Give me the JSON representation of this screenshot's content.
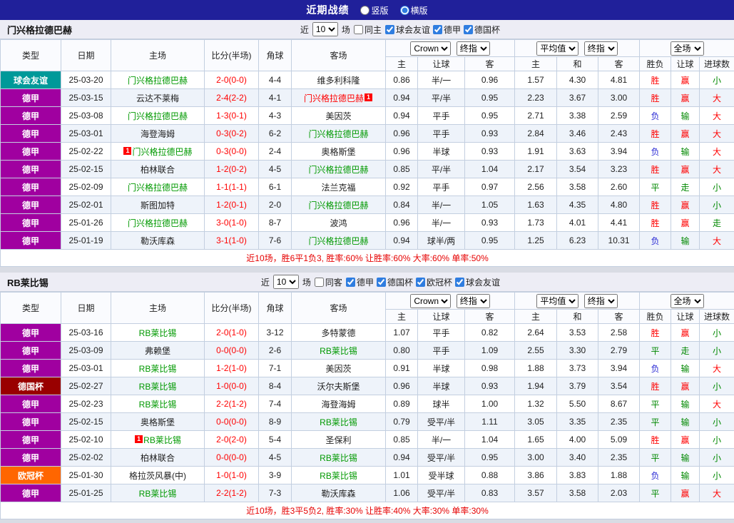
{
  "topbar": {
    "title": "近期战绩",
    "layout_options": [
      {
        "label": "竖版",
        "selected": false
      },
      {
        "label": "横版",
        "selected": true
      }
    ]
  },
  "table_header": {
    "type": "类型",
    "date": "日期",
    "home": "主场",
    "score": "比分(半场)",
    "corner": "角球",
    "away": "客场",
    "odds_source_select": "Crown",
    "odds_stage_select": "终指",
    "odds_sub": [
      "主",
      "让球",
      "客"
    ],
    "avg_select": "平均值",
    "avg_stage_select": "终指",
    "avg_sub": [
      "主",
      "和",
      "客"
    ],
    "scope_select": "全场",
    "result_sub": [
      "胜负",
      "让球",
      "进球数"
    ]
  },
  "colors": {
    "league": {
      "球会友谊": "#009999",
      "德甲": "#a000a0",
      "德国杯": "#990000",
      "欧冠杯": "#ff6600"
    },
    "team": {
      "self": "#009900",
      "opp": "#222222",
      "selfred": "#ff0000"
    },
    "score": "#ff0000",
    "result": {
      "胜": "#ff0000",
      "平": "#008800",
      "负": "#2929d4",
      "赢": "#ff0000",
      "输": "#008800",
      "走": "#008800",
      "大": "#ff0000",
      "小": "#008800"
    },
    "summary": "#e60000"
  },
  "sections": [
    {
      "team": "门兴格拉德巴赫",
      "filter": {
        "near": "近",
        "count": "10",
        "games": "场",
        "same": "同主",
        "competitions": [
          "球会友谊",
          "德甲",
          "德国杯"
        ]
      },
      "rows": [
        {
          "type": "球会友谊",
          "date": "25-03-20",
          "home": {
            "name": "门兴格拉德巴赫",
            "cls": "self"
          },
          "score": "2-0(0-0)",
          "corner": "4-4",
          "away": {
            "name": "维多利科隆",
            "cls": "opp"
          },
          "crown": [
            "0.86",
            "半/一",
            "0.96"
          ],
          "avg": [
            "1.57",
            "4.30",
            "4.81"
          ],
          "result": [
            "胜",
            "赢",
            "小"
          ]
        },
        {
          "type": "德甲",
          "date": "25-03-15",
          "home": {
            "name": "云达不莱梅",
            "cls": "opp"
          },
          "score": "2-4(2-2)",
          "corner": "4-1",
          "away": {
            "name": "门兴格拉德巴赫",
            "cls": "selfred",
            "badge": "1",
            "badge_pos": "after"
          },
          "crown": [
            "0.94",
            "平/半",
            "0.95"
          ],
          "avg": [
            "2.23",
            "3.67",
            "3.00"
          ],
          "result": [
            "胜",
            "赢",
            "大"
          ]
        },
        {
          "type": "德甲",
          "date": "25-03-08",
          "home": {
            "name": "门兴格拉德巴赫",
            "cls": "self"
          },
          "score": "1-3(0-1)",
          "corner": "4-3",
          "away": {
            "name": "美因茨",
            "cls": "opp"
          },
          "crown": [
            "0.94",
            "平手",
            "0.95"
          ],
          "avg": [
            "2.71",
            "3.38",
            "2.59"
          ],
          "result": [
            "负",
            "输",
            "大"
          ]
        },
        {
          "type": "德甲",
          "date": "25-03-01",
          "home": {
            "name": "海登海姆",
            "cls": "opp"
          },
          "score": "0-3(0-2)",
          "corner": "6-2",
          "away": {
            "name": "门兴格拉德巴赫",
            "cls": "self"
          },
          "crown": [
            "0.96",
            "平手",
            "0.93"
          ],
          "avg": [
            "2.84",
            "3.46",
            "2.43"
          ],
          "result": [
            "胜",
            "赢",
            "大"
          ]
        },
        {
          "type": "德甲",
          "date": "25-02-22",
          "home": {
            "name": "门兴格拉德巴赫",
            "cls": "self",
            "badge": "1",
            "badge_pos": "before"
          },
          "score": "0-3(0-0)",
          "corner": "2-4",
          "away": {
            "name": "奥格斯堡",
            "cls": "opp"
          },
          "crown": [
            "0.96",
            "半球",
            "0.93"
          ],
          "avg": [
            "1.91",
            "3.63",
            "3.94"
          ],
          "result": [
            "负",
            "输",
            "大"
          ]
        },
        {
          "type": "德甲",
          "date": "25-02-15",
          "home": {
            "name": "柏林联合",
            "cls": "opp"
          },
          "score": "1-2(0-2)",
          "corner": "4-5",
          "away": {
            "name": "门兴格拉德巴赫",
            "cls": "self"
          },
          "crown": [
            "0.85",
            "平/半",
            "1.04"
          ],
          "avg": [
            "2.17",
            "3.54",
            "3.23"
          ],
          "result": [
            "胜",
            "赢",
            "大"
          ]
        },
        {
          "type": "德甲",
          "date": "25-02-09",
          "home": {
            "name": "门兴格拉德巴赫",
            "cls": "self"
          },
          "score": "1-1(1-1)",
          "corner": "6-1",
          "away": {
            "name": "法兰克福",
            "cls": "opp"
          },
          "crown": [
            "0.92",
            "平手",
            "0.97"
          ],
          "avg": [
            "2.56",
            "3.58",
            "2.60"
          ],
          "result": [
            "平",
            "走",
            "小"
          ]
        },
        {
          "type": "德甲",
          "date": "25-02-01",
          "home": {
            "name": "斯图加特",
            "cls": "opp"
          },
          "score": "1-2(0-1)",
          "corner": "2-0",
          "away": {
            "name": "门兴格拉德巴赫",
            "cls": "self"
          },
          "crown": [
            "0.84",
            "半/一",
            "1.05"
          ],
          "avg": [
            "1.63",
            "4.35",
            "4.80"
          ],
          "result": [
            "胜",
            "赢",
            "小"
          ]
        },
        {
          "type": "德甲",
          "date": "25-01-26",
          "home": {
            "name": "门兴格拉德巴赫",
            "cls": "self"
          },
          "score": "3-0(1-0)",
          "corner": "8-7",
          "away": {
            "name": "波鸿",
            "cls": "opp"
          },
          "crown": [
            "0.96",
            "半/一",
            "0.93"
          ],
          "avg": [
            "1.73",
            "4.01",
            "4.41"
          ],
          "result": [
            "胜",
            "赢",
            "走"
          ]
        },
        {
          "type": "德甲",
          "date": "25-01-19",
          "home": {
            "name": "勒沃库森",
            "cls": "opp"
          },
          "score": "3-1(1-0)",
          "corner": "7-6",
          "away": {
            "name": "门兴格拉德巴赫",
            "cls": "self"
          },
          "crown": [
            "0.94",
            "球半/两",
            "0.95"
          ],
          "avg": [
            "1.25",
            "6.23",
            "10.31"
          ],
          "result": [
            "负",
            "输",
            "大"
          ]
        }
      ],
      "summary": "近10场，胜6平1负3, 胜率:60% 让胜率:60% 大率:60% 单率:50%"
    },
    {
      "team": "RB莱比锡",
      "filter": {
        "near": "近",
        "count": "10",
        "games": "场",
        "same": "同客",
        "competitions": [
          "德甲",
          "德国杯",
          "欧冠杯",
          "球会友谊"
        ]
      },
      "rows": [
        {
          "type": "德甲",
          "date": "25-03-16",
          "home": {
            "name": "RB莱比锡",
            "cls": "self"
          },
          "score": "2-0(1-0)",
          "corner": "3-12",
          "away": {
            "name": "多特蒙德",
            "cls": "opp"
          },
          "crown": [
            "1.07",
            "平手",
            "0.82"
          ],
          "avg": [
            "2.64",
            "3.53",
            "2.58"
          ],
          "result": [
            "胜",
            "赢",
            "小"
          ]
        },
        {
          "type": "德甲",
          "date": "25-03-09",
          "home": {
            "name": "弗赖堡",
            "cls": "opp"
          },
          "score": "0-0(0-0)",
          "corner": "2-6",
          "away": {
            "name": "RB莱比锡",
            "cls": "self"
          },
          "crown": [
            "0.80",
            "平手",
            "1.09"
          ],
          "avg": [
            "2.55",
            "3.30",
            "2.79"
          ],
          "result": [
            "平",
            "走",
            "小"
          ]
        },
        {
          "type": "德甲",
          "date": "25-03-01",
          "home": {
            "name": "RB莱比锡",
            "cls": "self"
          },
          "score": "1-2(1-0)",
          "corner": "7-1",
          "away": {
            "name": "美因茨",
            "cls": "opp"
          },
          "crown": [
            "0.91",
            "半球",
            "0.98"
          ],
          "avg": [
            "1.88",
            "3.73",
            "3.94"
          ],
          "result": [
            "负",
            "输",
            "大"
          ]
        },
        {
          "type": "德国杯",
          "date": "25-02-27",
          "home": {
            "name": "RB莱比锡",
            "cls": "self"
          },
          "score": "1-0(0-0)",
          "corner": "8-4",
          "away": {
            "name": "沃尔夫斯堡",
            "cls": "opp"
          },
          "crown": [
            "0.96",
            "半球",
            "0.93"
          ],
          "avg": [
            "1.94",
            "3.79",
            "3.54"
          ],
          "result": [
            "胜",
            "赢",
            "小"
          ]
        },
        {
          "type": "德甲",
          "date": "25-02-23",
          "home": {
            "name": "RB莱比锡",
            "cls": "self"
          },
          "score": "2-2(1-2)",
          "corner": "7-4",
          "away": {
            "name": "海登海姆",
            "cls": "opp"
          },
          "crown": [
            "0.89",
            "球半",
            "1.00"
          ],
          "avg": [
            "1.32",
            "5.50",
            "8.67"
          ],
          "result": [
            "平",
            "输",
            "大"
          ]
        },
        {
          "type": "德甲",
          "date": "25-02-15",
          "home": {
            "name": "奥格斯堡",
            "cls": "opp"
          },
          "score": "0-0(0-0)",
          "corner": "8-9",
          "away": {
            "name": "RB莱比锡",
            "cls": "self"
          },
          "crown": [
            "0.79",
            "受平/半",
            "1.11"
          ],
          "avg": [
            "3.05",
            "3.35",
            "2.35"
          ],
          "result": [
            "平",
            "输",
            "小"
          ]
        },
        {
          "type": "德甲",
          "date": "25-02-10",
          "home": {
            "name": "RB莱比锡",
            "cls": "self",
            "badge": "1",
            "badge_pos": "before"
          },
          "score": "2-0(2-0)",
          "corner": "5-4",
          "away": {
            "name": "圣保利",
            "cls": "opp"
          },
          "crown": [
            "0.85",
            "半/一",
            "1.04"
          ],
          "avg": [
            "1.65",
            "4.00",
            "5.09"
          ],
          "result": [
            "胜",
            "赢",
            "小"
          ]
        },
        {
          "type": "德甲",
          "date": "25-02-02",
          "home": {
            "name": "柏林联合",
            "cls": "opp"
          },
          "score": "0-0(0-0)",
          "corner": "4-5",
          "away": {
            "name": "RB莱比锡",
            "cls": "self"
          },
          "crown": [
            "0.94",
            "受平/半",
            "0.95"
          ],
          "avg": [
            "3.00",
            "3.40",
            "2.35"
          ],
          "result": [
            "平",
            "输",
            "小"
          ]
        },
        {
          "type": "欧冠杯",
          "date": "25-01-30",
          "home": {
            "name": "格拉茨风暴(中)",
            "cls": "opp"
          },
          "score": "1-0(1-0)",
          "corner": "3-9",
          "away": {
            "name": "RB莱比锡",
            "cls": "self"
          },
          "crown": [
            "1.01",
            "受半球",
            "0.88"
          ],
          "avg": [
            "3.86",
            "3.83",
            "1.88"
          ],
          "result": [
            "负",
            "输",
            "小"
          ]
        },
        {
          "type": "德甲",
          "date": "25-01-25",
          "home": {
            "name": "RB莱比锡",
            "cls": "self"
          },
          "score": "2-2(1-2)",
          "corner": "7-3",
          "away": {
            "name": "勒沃库森",
            "cls": "opp"
          },
          "crown": [
            "1.06",
            "受平/半",
            "0.83"
          ],
          "avg": [
            "3.57",
            "3.58",
            "2.03"
          ],
          "result": [
            "平",
            "赢",
            "大"
          ]
        }
      ],
      "summary": "近10场，胜3平5负2, 胜率:30% 让胜率:40% 大率:30% 单率:30%"
    }
  ]
}
